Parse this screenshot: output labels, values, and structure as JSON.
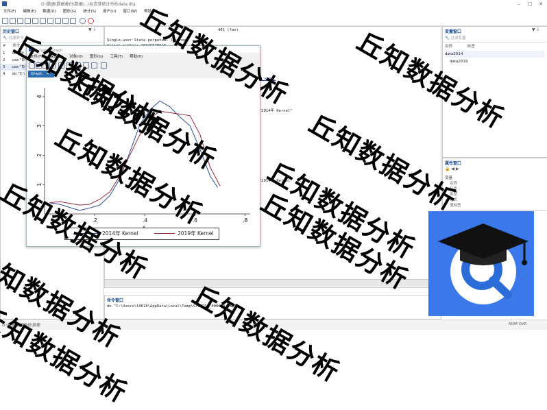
{
  "window": {
    "title": "D:\\数据\\数据备份\\数据\\...\\标志变统计分析data.dta"
  },
  "menu": [
    "文件(F)",
    "编辑(E)",
    "数据(D)",
    "图形(G)",
    "统计(S)",
    "用户(U)",
    "窗口(W)",
    "帮助(H)"
  ],
  "history": {
    "title": "历史窗口",
    "search_placeholder": "过滤命令",
    "col_num": "#",
    "col_cmd": "命令",
    "rows": [
      {
        "n": "1",
        "cmd": "doedit"
      },
      {
        "n": "2",
        "cmd": "use \"D:\\"
      },
      {
        "n": "3",
        "cmd": "use \"D:\\"
      },
      {
        "n": "4",
        "cmd": "do \"C:\\"
      }
    ]
  },
  "results": {
    "lines": [
      "Single-user Stata perpetual license:",
      "       Serial number:  10346578918",
      "\"2014年 Kernel\"",
      "\"2014年 Kernel\""
    ],
    "fax": "401 (fax)",
    "var": "m_xvar."
  },
  "graph": {
    "title": "Graph - Graph",
    "menu": [
      "文件(F)",
      "编辑(E)",
      "对象(O)",
      "图形(G)",
      "工具(T)",
      "帮助(H)"
    ],
    "tab": "Graph",
    "y_ticks": [
      "4",
      "3",
      "2",
      "1",
      "0"
    ],
    "x_ticks": [
      ".2",
      ".4",
      ".6",
      ".8"
    ],
    "xlabel": "x",
    "legend": [
      "2014年 Kernel",
      "2019年 Kernel"
    ]
  },
  "chart_data": {
    "type": "line",
    "xlabel": "x",
    "ylabel": "",
    "xlim": [
      0.0,
      0.82
    ],
    "ylim": [
      0.0,
      4.3
    ],
    "x_ticks": [
      0.2,
      0.4,
      0.6,
      0.8
    ],
    "y_ticks": [
      0,
      1,
      2,
      3,
      4
    ],
    "legend_position": "bottom",
    "series": [
      {
        "name": "2014年 Kernel",
        "color": "#2b4d8f",
        "x": [
          0.02,
          0.06,
          0.1,
          0.14,
          0.18,
          0.22,
          0.26,
          0.3,
          0.34,
          0.38,
          0.42,
          0.46,
          0.5,
          0.54,
          0.58,
          0.62,
          0.66,
          0.69
        ],
        "y": [
          0.38,
          0.33,
          0.22,
          0.12,
          0.2,
          0.3,
          0.62,
          1.2,
          2.1,
          3.05,
          3.55,
          3.85,
          3.65,
          3.3,
          3.0,
          2.2,
          1.3,
          0.9
        ]
      },
      {
        "name": "2019年 Kernel",
        "color": "#8b2a3a",
        "x": [
          0.02,
          0.06,
          0.1,
          0.14,
          0.18,
          0.22,
          0.26,
          0.3,
          0.34,
          0.38,
          0.42,
          0.46,
          0.5,
          0.54,
          0.58,
          0.62,
          0.66,
          0.7
        ],
        "y": [
          0.38,
          0.42,
          0.36,
          0.3,
          0.33,
          0.5,
          0.75,
          1.3,
          2.0,
          2.7,
          3.25,
          3.5,
          3.45,
          3.4,
          3.35,
          2.7,
          1.6,
          0.95
        ]
      }
    ]
  },
  "variables": {
    "title": "变量窗口",
    "search_placeholder": "过滤变量",
    "col_name": "名称",
    "col_label": "标签",
    "rows": [
      "data2014",
      "data2019"
    ]
  },
  "properties": {
    "title": "属性窗口",
    "section": "变量",
    "fields": [
      "名称",
      "标签",
      "类型",
      "格式",
      "值标签"
    ]
  },
  "command": {
    "title": "命令窗口",
    "value": "do \"C:\\Users\\10618\\AppData\\Local\\Temp\\STD4794_000000.tmp\""
  },
  "status": {
    "path": "D:\\数据\\数据备份\\数据",
    "right": "NUM  OVR"
  },
  "watermark": "丘知数据分析"
}
